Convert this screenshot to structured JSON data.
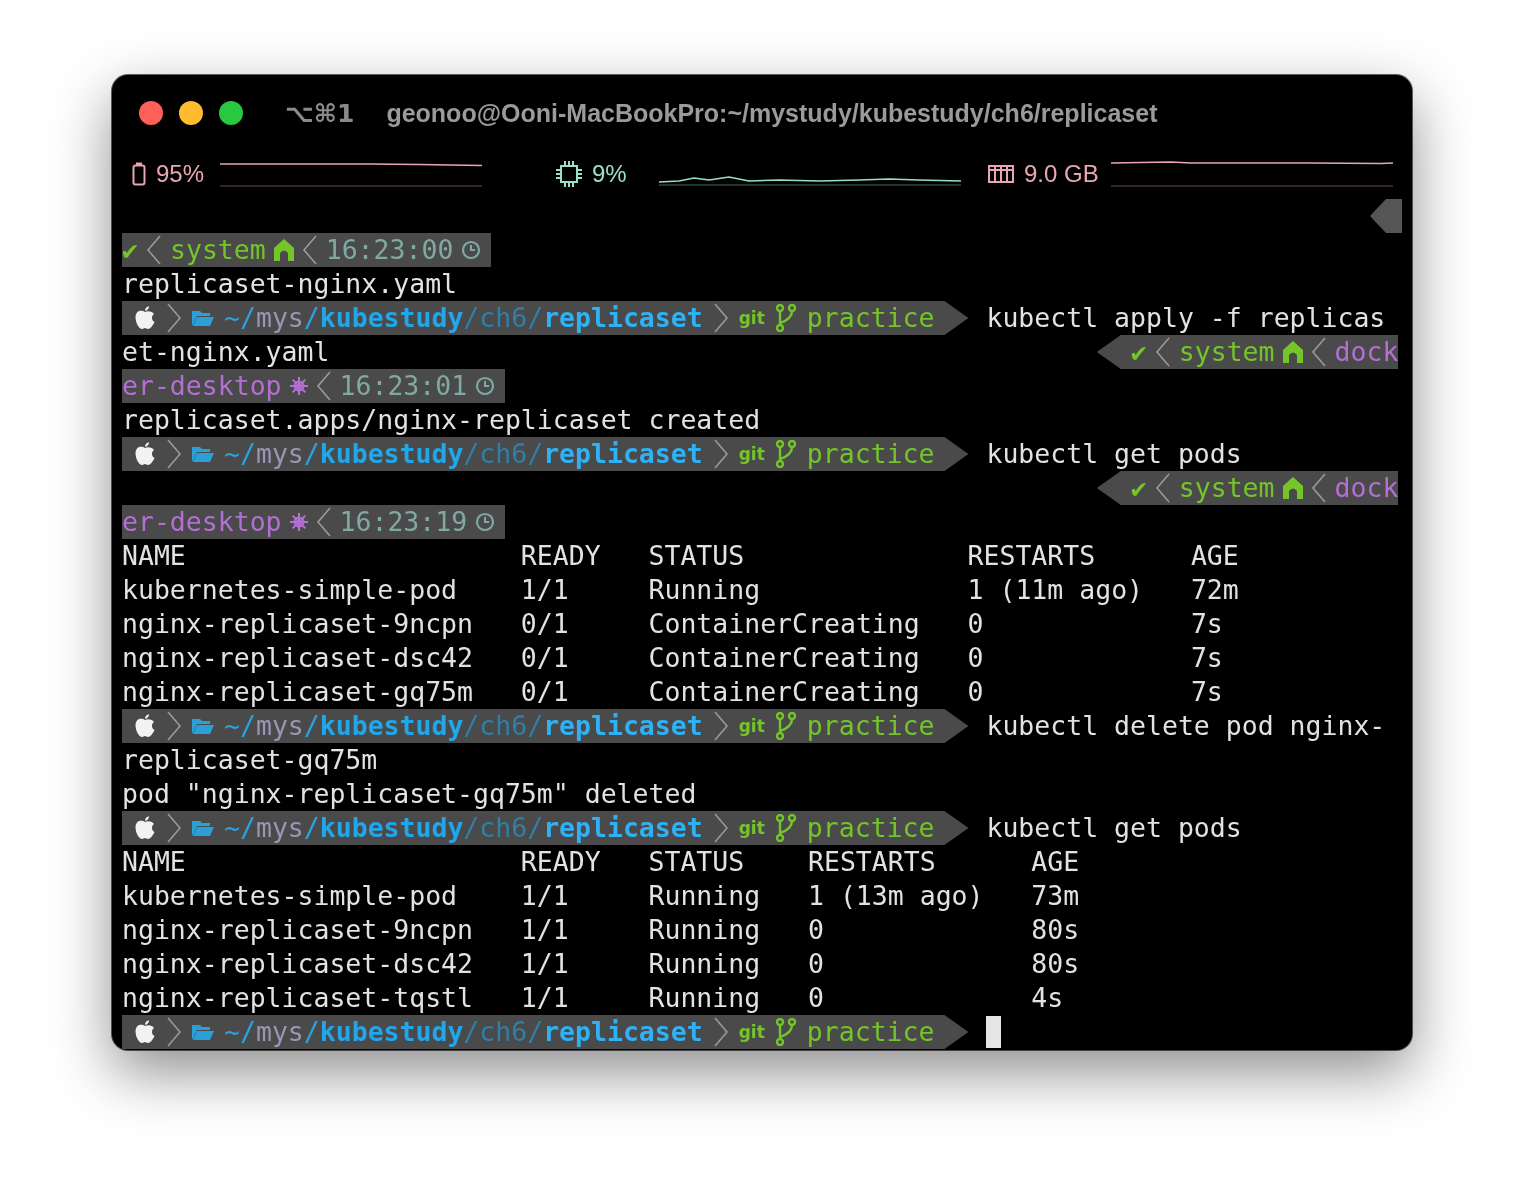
{
  "window": {
    "shortcut": "⌥⌘1",
    "title": "geonoo@Ooni-MacBookPro:~/mystudy/kubestudy/ch6/replicaset"
  },
  "stats": [
    {
      "kind": "battery",
      "value": "95%"
    },
    {
      "kind": "cpu",
      "value": "9%"
    },
    {
      "kind": "memory",
      "value": "9.0 GB"
    }
  ],
  "lines": [
    {
      "kind": "status",
      "parts": [
        {
          "kind": "check",
          "text": "✔"
        },
        {
          "kind": "context",
          "text": "system"
        },
        {
          "kind": "time",
          "text": "16:23:00"
        }
      ]
    },
    {
      "kind": "output",
      "text": "replicaset-nginx.yaml"
    },
    {
      "kind": "prompt",
      "path": [
        {
          "text": "~/",
          "kind": "plain"
        },
        {
          "text": "mys",
          "kind": "short"
        },
        {
          "text": "/",
          "kind": "plain"
        },
        {
          "text": "kubestudy",
          "kind": "anchor"
        },
        {
          "text": "/ch6/",
          "kind": "dim"
        },
        {
          "text": "replicaset",
          "kind": "current"
        }
      ],
      "vcs": "git",
      "branch": "practice",
      "command": "kubectl apply -f replicas",
      "cursor": false
    },
    {
      "kind": "output",
      "text": "et-nginx.yaml",
      "status": [
        {
          "kind": "check",
          "text": "✔"
        },
        {
          "kind": "context",
          "text": "system"
        },
        {
          "kind": "kube",
          "text": "dock",
          "clipped": true
        }
      ]
    },
    {
      "kind": "status",
      "parts": [
        {
          "kind": "kube",
          "text": "er-desktop"
        },
        {
          "kind": "time",
          "text": "16:23:01"
        }
      ]
    },
    {
      "kind": "output",
      "text": "replicaset.apps/nginx-replicaset created"
    },
    {
      "kind": "prompt",
      "path": [
        {
          "text": "~/",
          "kind": "plain"
        },
        {
          "text": "mys",
          "kind": "short"
        },
        {
          "text": "/",
          "kind": "plain"
        },
        {
          "text": "kubestudy",
          "kind": "anchor"
        },
        {
          "text": "/ch6/",
          "kind": "dim"
        },
        {
          "text": "replicaset",
          "kind": "current"
        }
      ],
      "vcs": "git",
      "branch": "practice",
      "command": "kubectl get pods",
      "cursor": false
    },
    {
      "kind": "output",
      "status": [
        {
          "kind": "check",
          "text": "✔"
        },
        {
          "kind": "context",
          "text": "system"
        },
        {
          "kind": "kube",
          "text": "dock",
          "clipped": true
        }
      ]
    },
    {
      "kind": "status",
      "parts": [
        {
          "kind": "kube",
          "text": "er-desktop"
        },
        {
          "kind": "time",
          "text": "16:23:19"
        }
      ]
    },
    {
      "kind": "table",
      "columns": [
        "NAME",
        "READY",
        "STATUS",
        "RESTARTS",
        "AGE"
      ],
      "rows": [
        [
          "kubernetes-simple-pod",
          "1/1",
          "Running",
          "1 (11m ago)",
          "72m"
        ],
        [
          "nginx-replicaset-9ncpn",
          "0/1",
          "ContainerCreating",
          "0",
          "7s"
        ],
        [
          "nginx-replicaset-dsc42",
          "0/1",
          "ContainerCreating",
          "0",
          "7s"
        ],
        [
          "nginx-replicaset-gq75m",
          "0/1",
          "ContainerCreating",
          "0",
          "7s"
        ]
      ]
    },
    {
      "kind": "prompt",
      "path": [
        {
          "text": "~/",
          "kind": "plain"
        },
        {
          "text": "mys",
          "kind": "short"
        },
        {
          "text": "/",
          "kind": "plain"
        },
        {
          "text": "kubestudy",
          "kind": "anchor"
        },
        {
          "text": "/ch6/",
          "kind": "dim"
        },
        {
          "text": "replicaset",
          "kind": "current"
        }
      ],
      "vcs": "git",
      "branch": "practice",
      "command": "kubectl delete pod nginx-",
      "cursor": false
    },
    {
      "kind": "output",
      "text": "replicaset-gq75m"
    },
    {
      "kind": "output",
      "text": "pod \"nginx-replicaset-gq75m\" deleted"
    },
    {
      "kind": "prompt",
      "path": [
        {
          "text": "~/",
          "kind": "plain"
        },
        {
          "text": "mys",
          "kind": "short"
        },
        {
          "text": "/",
          "kind": "plain"
        },
        {
          "text": "kubestudy",
          "kind": "anchor"
        },
        {
          "text": "/ch6/",
          "kind": "dim"
        },
        {
          "text": "replicaset",
          "kind": "current"
        }
      ],
      "vcs": "git",
      "branch": "practice",
      "command": "kubectl get pods",
      "cursor": false
    },
    {
      "kind": "table",
      "columns": [
        "NAME",
        "READY",
        "STATUS",
        "RESTARTS",
        "AGE"
      ],
      "rows": [
        [
          "kubernetes-simple-pod",
          "1/1",
          "Running",
          "1 (13m ago)",
          "73m"
        ],
        [
          "nginx-replicaset-9ncpn",
          "1/1",
          "Running",
          "0",
          "80s"
        ],
        [
          "nginx-replicaset-dsc42",
          "1/1",
          "Running",
          "0",
          "80s"
        ],
        [
          "nginx-replicaset-tqstl",
          "1/1",
          "Running",
          "0",
          "4s"
        ]
      ]
    },
    {
      "kind": "prompt",
      "path": [
        {
          "text": "~/",
          "kind": "plain"
        },
        {
          "text": "mys",
          "kind": "short"
        },
        {
          "text": "/",
          "kind": "plain"
        },
        {
          "text": "kubestudy",
          "kind": "anchor"
        },
        {
          "text": "/ch6/",
          "kind": "dim"
        },
        {
          "text": "replicaset",
          "kind": "current"
        }
      ],
      "vcs": "git",
      "branch": "practice",
      "cursor": true
    }
  ]
}
